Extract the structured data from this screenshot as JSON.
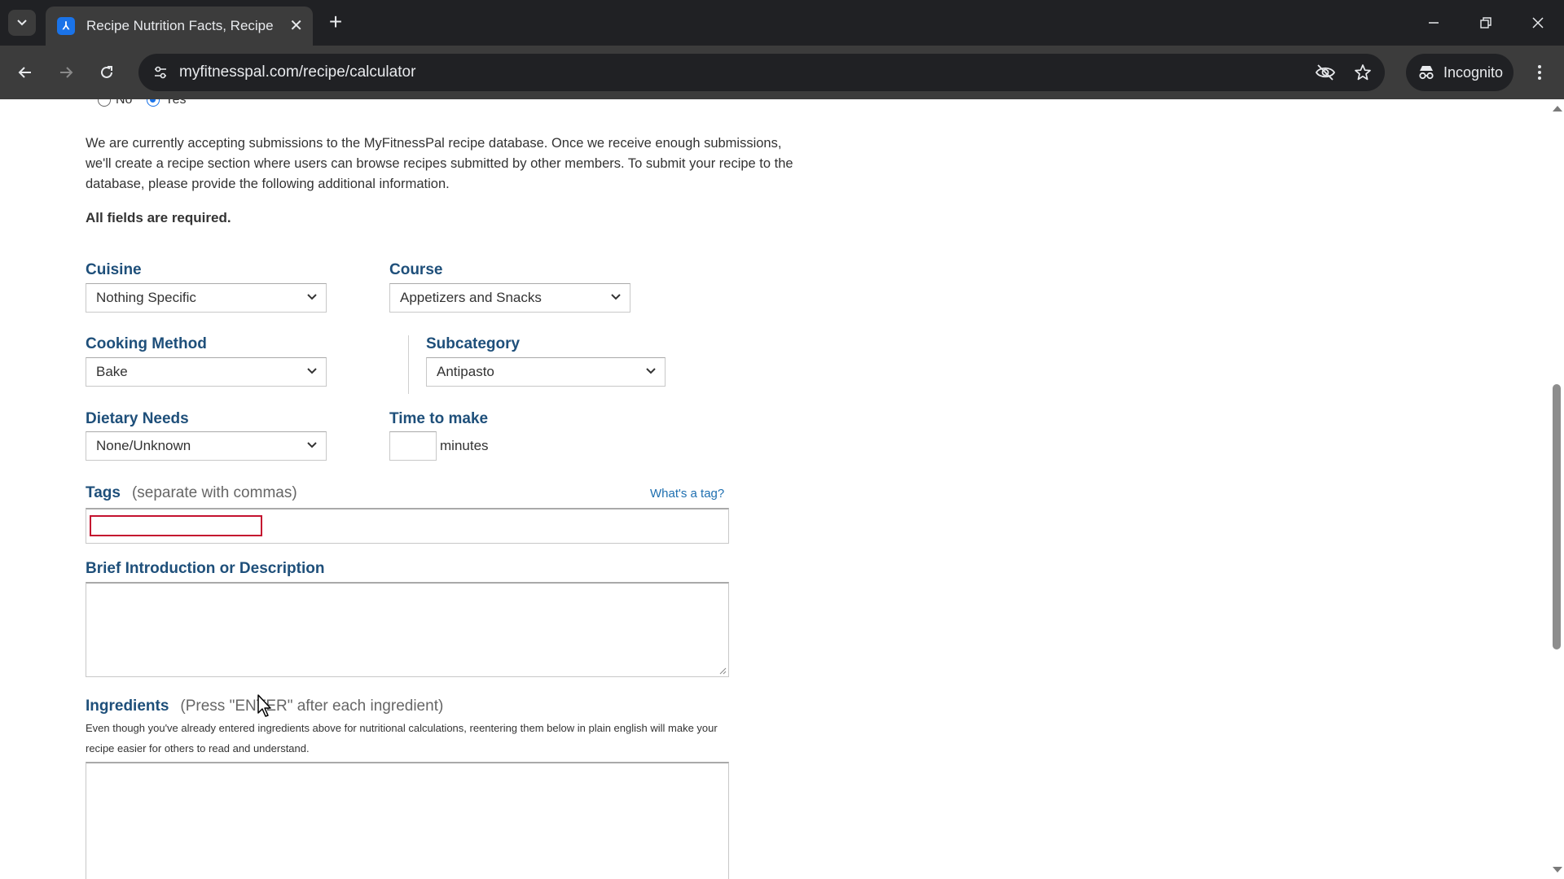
{
  "browser": {
    "tab_title": "Recipe Nutrition Facts, Recipe N",
    "favicon_letter": "⅄",
    "url": "myfitnesspal.com/recipe/calculator",
    "incognito_label": "Incognito"
  },
  "page": {
    "radio_no_label": "No",
    "radio_yes_label": "Yes",
    "radio_selected": "Yes",
    "intro_text": "We are currently accepting submissions to the MyFitnessPal recipe database. Once we receive enough submissions, we'll create a recipe section where users can browse recipes submitted by other members. To submit your recipe to the database, please provide the following additional information.",
    "required_note": "All fields are required.",
    "cuisine": {
      "label": "Cuisine",
      "value": "Nothing Specific"
    },
    "course": {
      "label": "Course",
      "value": "Appetizers and Snacks"
    },
    "cooking_method": {
      "label": "Cooking Method",
      "value": "Bake"
    },
    "subcategory": {
      "label": "Subcategory",
      "value": "Antipasto"
    },
    "dietary_needs": {
      "label": "Dietary Needs",
      "value": "None/Unknown"
    },
    "time_to_make": {
      "label": "Time to make",
      "value": "",
      "unit": "minutes"
    },
    "tags": {
      "label": "Tags",
      "hint": "(separate with commas)",
      "help_link": "What's a tag?",
      "value": ""
    },
    "description": {
      "label": "Brief Introduction or Description",
      "value": ""
    },
    "ingredients": {
      "label": "Ingredients",
      "hint": "(Press \"ENTER\" after each ingredient)",
      "note": "Even though you've already entered ingredients above for nutritional calculations, reentering them below in plain english will make your recipe easier for others to read and understand.",
      "value": ""
    }
  },
  "colors": {
    "label_blue": "#1e4f7a",
    "link_blue": "#1e6fb0",
    "error_red": "#c4122f",
    "chrome_dark": "#202124",
    "chrome_toolbar": "#3c3c3c"
  }
}
